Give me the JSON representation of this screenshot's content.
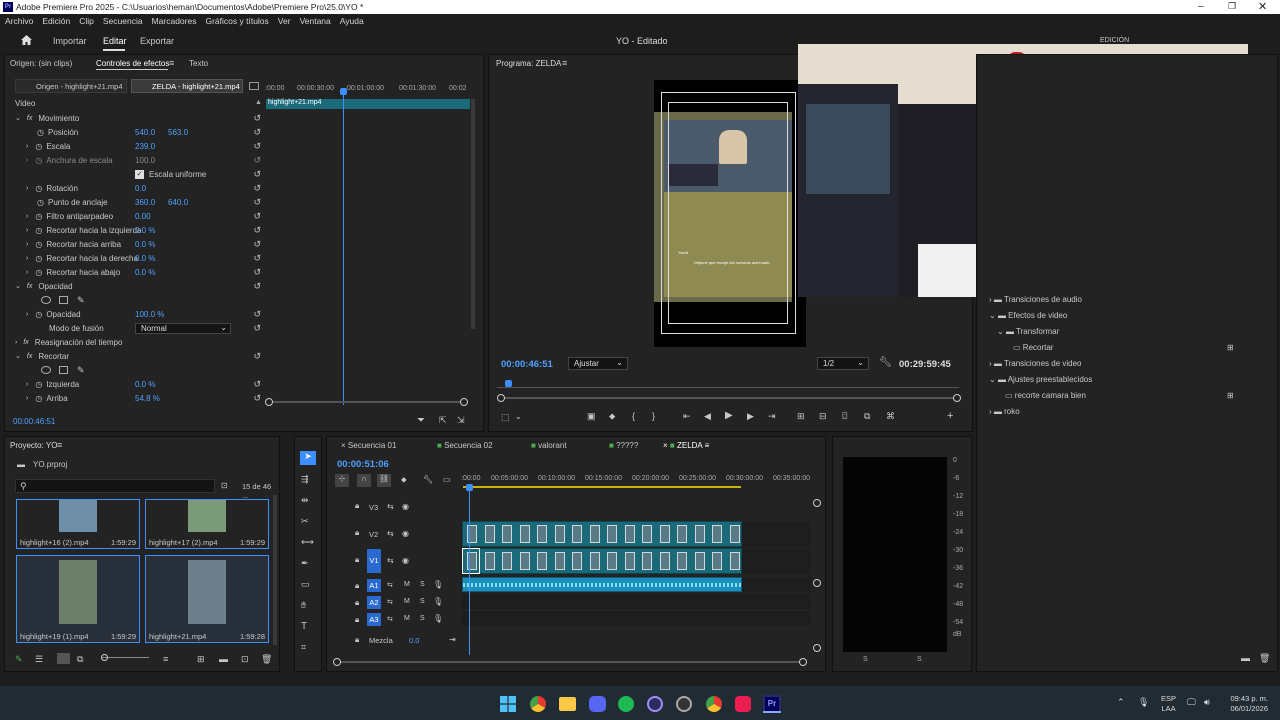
{
  "window": {
    "title": "Adobe Premiere Pro 2025 - C:\\Usuarios\\heman\\Documentos\\Adobe\\Premiere Pro\\25.0\\YO *"
  },
  "menu": [
    "Archivo",
    "Edición",
    "Clip",
    "Secuencia",
    "Marcadores",
    "Gráficos y títulos",
    "Ver",
    "Ventana",
    "Ayuda"
  ],
  "workspace": {
    "tabs": [
      "Importar",
      "Editar",
      "Exportar"
    ],
    "title": "YO - Editado",
    "right_label": "EDICIÓN"
  },
  "source_panel": {
    "tabs": [
      "Origen: (sin clips)",
      "Controles de efectos",
      "Texto"
    ],
    "clip_tabs": [
      "Origen - highlight+21.mp4",
      "ZELDA - highlight+21.mp4"
    ],
    "ruler": [
      ":00:00",
      "00:00:30:00",
      "00:01:00:00",
      "00:01:30:00",
      "00:02"
    ],
    "clip_label": "highlight+21.mp4",
    "time": "00:00:46:51"
  },
  "effects": {
    "video_label": "Video",
    "movimiento": "Movimiento",
    "props": [
      {
        "name": "Posición",
        "v1": "540.0",
        "v2": "563.0"
      },
      {
        "name": "Escala",
        "v1": "239.0",
        "v2": ""
      },
      {
        "name": "Anchura de escala",
        "v1": "100.0",
        "v2": ""
      },
      {
        "name": "Escala uniforme",
        "v1": "",
        "v2": ""
      },
      {
        "name": "Rotación",
        "v1": "0.0",
        "v2": ""
      },
      {
        "name": "Punto de anclaje",
        "v1": "360.0",
        "v2": "640.0"
      },
      {
        "name": "Filtro antiparpadeo",
        "v1": "0.00",
        "v2": ""
      },
      {
        "name": "Recortar hacia la izquierda",
        "v1": "0.0 %",
        "v2": ""
      },
      {
        "name": "Recortar hacia arriba",
        "v1": "0.0 %",
        "v2": ""
      },
      {
        "name": "Recortar hacia la derecha",
        "v1": "0.0 %",
        "v2": ""
      },
      {
        "name": "Recortar hacia abajo",
        "v1": "0.0 %",
        "v2": ""
      }
    ],
    "opacidad": "Opacidad",
    "opacidad_value": "100.0 %",
    "modo": "Modo de fusión",
    "modo_value": "Normal",
    "reasignacion": "Reasignación del tiempo",
    "recortar": "Recortar",
    "izquierda": "Izquierda",
    "izquierda_value": "0.0 %",
    "arriba": "Arriba",
    "arriba_value": "54.8 %"
  },
  "program": {
    "title": "Programa: ZELDA",
    "time": "00:00:46:51",
    "fit": "Ajustar",
    "quality": "1/2",
    "duration": "00:29:59:45",
    "caption": "Déjame que escaje las nuestras adecuado"
  },
  "right_panel": {
    "items": [
      "Transiciones de audio",
      "Efectos de video",
      "Transformar",
      "Recortar",
      "Transiciones de video",
      "Ajustes preestablecidos",
      "recorte camara bien",
      "roko"
    ]
  },
  "project": {
    "title": "Proyecto: YO",
    "file": "YO.prproj",
    "count": "15 de 46 ...",
    "items": [
      {
        "name": "highlight+16 (2).mp4",
        "dur": "1:59:29"
      },
      {
        "name": "highlight+17 (2).mp4",
        "dur": "1:59:29"
      },
      {
        "name": "highlight+19 (1).mp4",
        "dur": "1:59:29"
      },
      {
        "name": "highlight+21.mp4",
        "dur": "1:59:28"
      }
    ]
  },
  "timeline": {
    "tabs": [
      "Secuencia 01",
      "Secuencia 02",
      "valorant",
      "?????",
      "ZELDA"
    ],
    "time": "00:00:51:06",
    "ruler": [
      ":00:00",
      "00:05:00:00",
      "00:10:00:00",
      "00:15:00:00",
      "00:20:00:00",
      "00:25:00:00",
      "00:30:00:00",
      "00:35:00:00"
    ],
    "tracks": {
      "v3": "V3",
      "v2": "V2",
      "v1": "V1",
      "a1": "A1",
      "a2": "A2",
      "a3": "A3",
      "mezcla": "Mezcla",
      "mezcla_value": "0.0"
    }
  },
  "meter": {
    "scale": [
      "0",
      "-6",
      "-12",
      "-18",
      "-24",
      "-30",
      "-36",
      "-42",
      "-48",
      "-54",
      "dB"
    ],
    "bottom": [
      "S",
      "S"
    ]
  },
  "taskbar": {
    "lang1": "ESP",
    "lang2": "LAA",
    "time": "09:43 p. m.",
    "date": "06/01/2026"
  }
}
